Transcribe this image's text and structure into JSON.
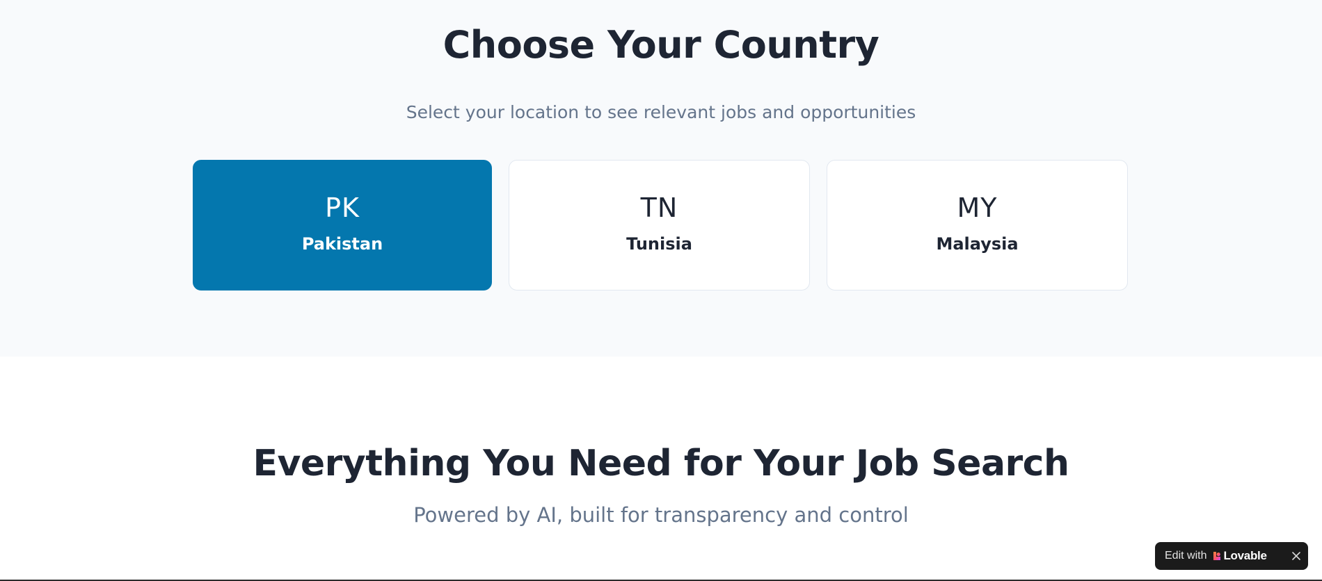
{
  "country_section": {
    "title": "Choose Your Country",
    "subtitle": "Select your location to see relevant jobs and opportunities",
    "countries": [
      {
        "code": "PK",
        "name": "Pakistan",
        "selected": true
      },
      {
        "code": "TN",
        "name": "Tunisia",
        "selected": false
      },
      {
        "code": "MY",
        "name": "Malaysia",
        "selected": false
      }
    ]
  },
  "features_section": {
    "title": "Everything You Need for Your Job Search",
    "subtitle": "Powered by AI, built for transparency and control"
  },
  "lovable_badge": {
    "edit_label": "Edit with",
    "brand": "Lovable",
    "close_icon": "close-icon"
  },
  "colors": {
    "accent": "#0477ae",
    "heading": "#1e2533",
    "muted": "#64748b",
    "section_bg": "#f8fafc"
  }
}
